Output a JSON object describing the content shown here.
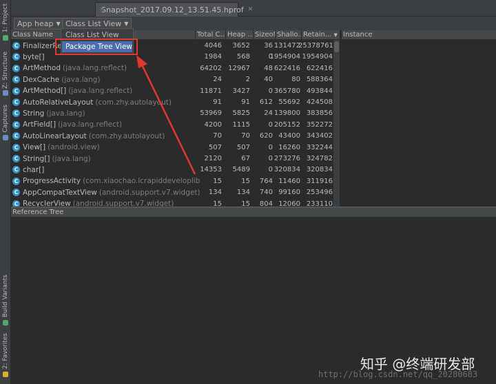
{
  "left_strip": {
    "tabs": [
      {
        "label": "1: Project",
        "icon": "project-icon",
        "color": "#59a869"
      },
      {
        "label": "Z: Structure",
        "icon": "structure-icon",
        "color": "#6a8fbf"
      },
      {
        "label": "Captures",
        "icon": "captures-icon",
        "color": "#6a8fbf"
      },
      {
        "label": "Build Variants",
        "icon": "build-variants-icon",
        "color": "#59a869"
      },
      {
        "label": "2: Favorites",
        "icon": "favorites-icon",
        "color": "#d9b32b"
      }
    ]
  },
  "editor_tab": {
    "label": "Snapshot_2017.09.12_13.51.45.hprof",
    "icon": "file-icon",
    "close_icon": "close-icon"
  },
  "toolbar": {
    "heap_select": "App heap",
    "view_select": "Class List View"
  },
  "dropdown": {
    "options": [
      "Class List View",
      "Package Tree View"
    ],
    "highlighted": "Package Tree View"
  },
  "table": {
    "columns": [
      "Class Name",
      "Total C...",
      "Heap ...",
      "Sizeof",
      "Shallo...",
      "Retain..."
    ],
    "sort_indicator": "▼",
    "rows": [
      {
        "name": "FinalizerRef",
        "pkg": "",
        "total": "4046",
        "heap": "3652",
        "sizeof": "36",
        "shallow": "131472",
        "retained": "25378761"
      },
      {
        "name": "byte[]",
        "pkg": "",
        "total": "1984",
        "heap": "568",
        "sizeof": "0",
        "shallow": "1954904",
        "retained": "1954904"
      },
      {
        "name": "ArtMethod",
        "pkg": "(java.lang.reflect)",
        "total": "64202",
        "heap": "12967",
        "sizeof": "48",
        "shallow": "622416",
        "retained": "622416"
      },
      {
        "name": "DexCache",
        "pkg": "(java.lang)",
        "total": "24",
        "heap": "2",
        "sizeof": "40",
        "shallow": "80",
        "retained": "588364"
      },
      {
        "name": "ArtMethod[]",
        "pkg": "(java.lang.reflect)",
        "total": "11871",
        "heap": "3427",
        "sizeof": "0",
        "shallow": "365780",
        "retained": "493844"
      },
      {
        "name": "AutoRelativeLayout",
        "pkg": "(com.zhy.autolayout)",
        "total": "91",
        "heap": "91",
        "sizeof": "612",
        "shallow": "55692",
        "retained": "424508"
      },
      {
        "name": "String",
        "pkg": "(java.lang)",
        "total": "53969",
        "heap": "5825",
        "sizeof": "24",
        "shallow": "139800",
        "retained": "383856"
      },
      {
        "name": "ArtField[]",
        "pkg": "(java.lang.reflect)",
        "total": "4200",
        "heap": "1115",
        "sizeof": "0",
        "shallow": "205152",
        "retained": "352272"
      },
      {
        "name": "AutoLinearLayout",
        "pkg": "(com.zhy.autolayout)",
        "total": "70",
        "heap": "70",
        "sizeof": "620",
        "shallow": "43400",
        "retained": "343402"
      },
      {
        "name": "View[]",
        "pkg": "(android.view)",
        "total": "507",
        "heap": "507",
        "sizeof": "0",
        "shallow": "16260",
        "retained": "332244"
      },
      {
        "name": "String[]",
        "pkg": "(java.lang)",
        "total": "2120",
        "heap": "67",
        "sizeof": "0",
        "shallow": "273276",
        "retained": "324782"
      },
      {
        "name": "char[]",
        "pkg": "",
        "total": "14353",
        "heap": "5489",
        "sizeof": "0",
        "shallow": "320834",
        "retained": "320834"
      },
      {
        "name": "ProgressActivity",
        "pkg": "(com.xiaochao.lcrapiddeveloplibrary.vie",
        "total": "15",
        "heap": "15",
        "sizeof": "764",
        "shallow": "11460",
        "retained": "311916"
      },
      {
        "name": "AppCompatTextView",
        "pkg": "(android.support.v7.widget)",
        "total": "134",
        "heap": "134",
        "sizeof": "740",
        "shallow": "99160",
        "retained": "253496"
      },
      {
        "name": "RecyclerView",
        "pkg": "(android.support.v7.widget)",
        "total": "15",
        "heap": "15",
        "sizeof": "804",
        "shallow": "12060",
        "retained": "233110"
      }
    ]
  },
  "instance_panel": {
    "title": "Instance"
  },
  "reference_panel": {
    "title": "Reference Tree"
  },
  "watermark": {
    "zhihu": "知乎 @终端研发部",
    "url": "http://blog.csdn.net/qq_20280683"
  },
  "colors": {
    "annotation_red": "#e13834",
    "selection_blue": "#4b6eaf",
    "class_icon": "#3592c4"
  }
}
